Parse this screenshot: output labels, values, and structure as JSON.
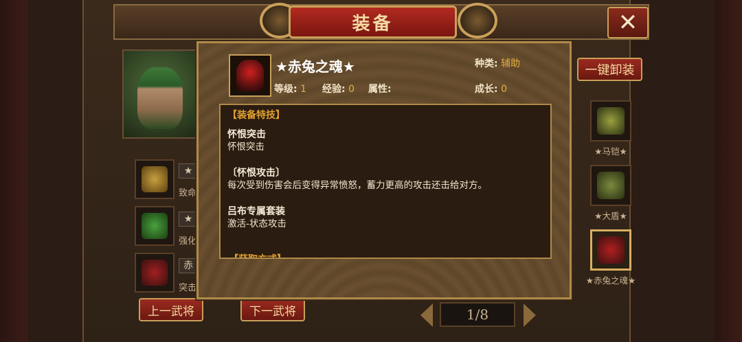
{
  "window": {
    "title": "装备",
    "close_symbol": "✕"
  },
  "hero": {
    "slots": [
      {
        "badge": "★",
        "text": "致命"
      },
      {
        "badge": "★",
        "text": "强化"
      },
      {
        "badge": "赤",
        "text": "突击"
      }
    ],
    "prev_label": "上一武将",
    "next_label": "下一武将"
  },
  "pager": {
    "text": "1/8"
  },
  "equip_column": {
    "unequip_all_label": "一键卸装",
    "items": [
      {
        "label": "★马铠★"
      },
      {
        "label": "★大盾★"
      },
      {
        "label": "★赤兔之魂★"
      }
    ]
  },
  "popup": {
    "name": "★赤兔之魂★",
    "kind_label": "种类:",
    "kind_value": "辅助",
    "level_label": "等级:",
    "level_value": "1",
    "exp_label": "经验:",
    "exp_value": "0",
    "attr_label": "属性:",
    "growth_label": "成长:",
    "growth_value": "0",
    "desc": {
      "header": "【装备特技】",
      "blocks": [
        {
          "title": "怀恨突击",
          "text": "怀恨突击"
        },
        {
          "title": "〔怀恨攻击〕",
          "text": "每次受到伤害会后变得异常愤怒，蓄力更高的攻击还击给对方。"
        },
        {
          "title": "吕布专属套装",
          "text": "激活-状态攻击"
        }
      ],
      "footer": "【获取方式】"
    }
  },
  "colors": {
    "accent_gold": "#e0b040",
    "button_red": "#9a2a20",
    "border_gold": "#c9a05a"
  }
}
